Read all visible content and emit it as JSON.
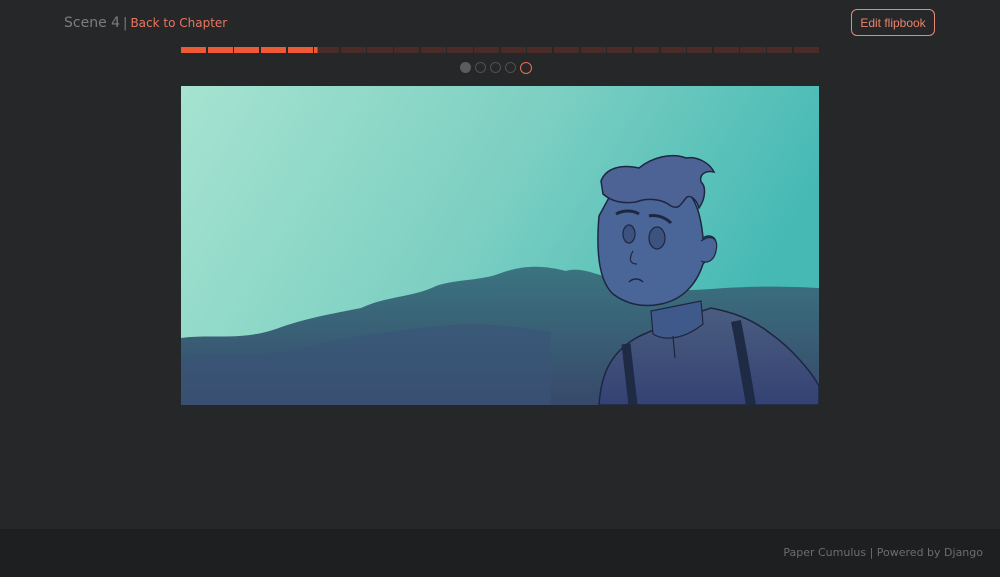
{
  "header": {
    "scene_title": "Scene 4",
    "separator": "|",
    "back_link": "Back to Chapter",
    "edit_button": "Edit flipbook"
  },
  "progress": {
    "total_segments": 24,
    "filled_segments": 5,
    "partial_fraction_of_next": 0.15,
    "filled_color": "#ee5a35",
    "empty_color": "#4a2b28"
  },
  "pager": {
    "count": 5,
    "filled_dots": 1,
    "active_dot": 5,
    "active_color": "#e8704f"
  },
  "footer": {
    "text": "Paper Cumulus | Powered by Django"
  }
}
